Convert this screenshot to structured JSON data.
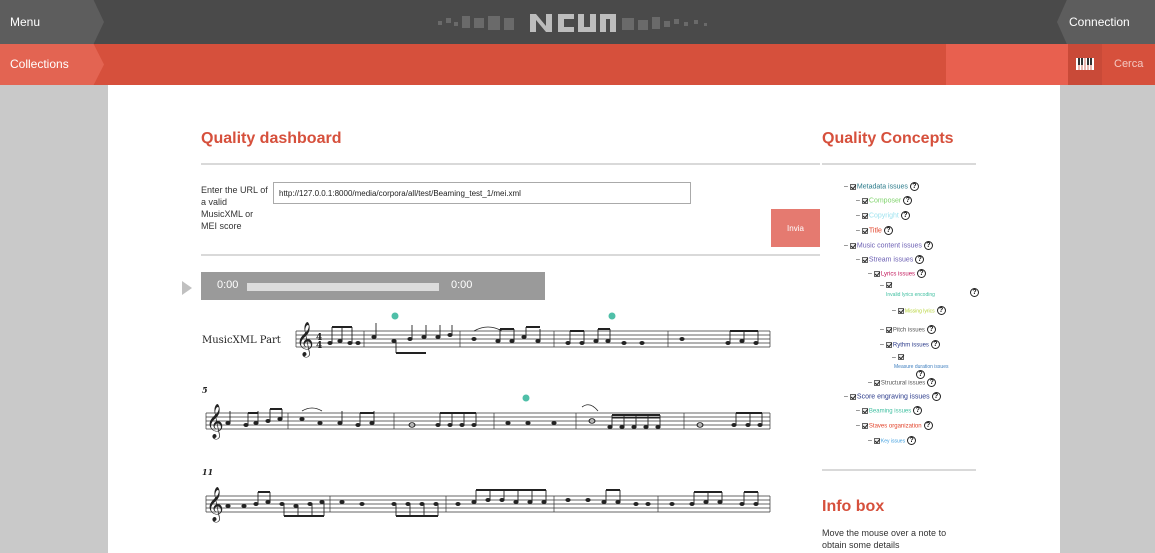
{
  "header": {
    "menu_label": "Menu",
    "connection_label": "Connection",
    "collections_label": "Collections",
    "search_label": "Cerca"
  },
  "dashboard": {
    "title": "Quality dashboard",
    "url_label": "Enter the URL of a valid MusicXML or MEI score",
    "url_value": "http://127.0.0.1:8000/media/corpora/all/test/Beaming_test_1/mei.xml",
    "submit_label": "Invia"
  },
  "player": {
    "current_time": "0:00",
    "total_time": "0:00"
  },
  "score": {
    "part_name": "MusicXML Part",
    "measure_numbers": [
      "5",
      "11"
    ]
  },
  "concepts": {
    "title": "Quality Concepts",
    "items": [
      {
        "label": "Metadata issues",
        "color": "#2a7a8a"
      },
      {
        "label": "Composer",
        "color": "#7fd36b"
      },
      {
        "label": "Copyright",
        "color": "#9fe3ef"
      },
      {
        "label": "Title",
        "color": "#e2432a"
      },
      {
        "label": "Music content issues",
        "color": "#6b5fb3"
      },
      {
        "label": "Stream issues",
        "color": "#6b5fb3"
      },
      {
        "label": "Lyrics issues",
        "color": "#c2185b"
      },
      {
        "label": "Invalid lyrics encoding",
        "color": "#3fbfa0"
      },
      {
        "label": "Missing lyrics",
        "color": "#b5d336"
      },
      {
        "label": "Pitch issues",
        "color": "#555555"
      },
      {
        "label": "Rythm issues",
        "color": "#2a3a8a"
      },
      {
        "label": "Measure duration issues",
        "color": "#3f7fbf"
      },
      {
        "label": "Structural issues",
        "color": "#555555"
      },
      {
        "label": "Score engraving issues",
        "color": "#2a3a8a"
      },
      {
        "label": "Beaming issues",
        "color": "#3fbfa0"
      },
      {
        "label": "Staves organization",
        "color": "#e2432a"
      },
      {
        "label": "Key issues",
        "color": "#3f9fdf"
      }
    ]
  },
  "info": {
    "title": "Info box",
    "text": "Move the mouse over a note to obtain some details"
  }
}
